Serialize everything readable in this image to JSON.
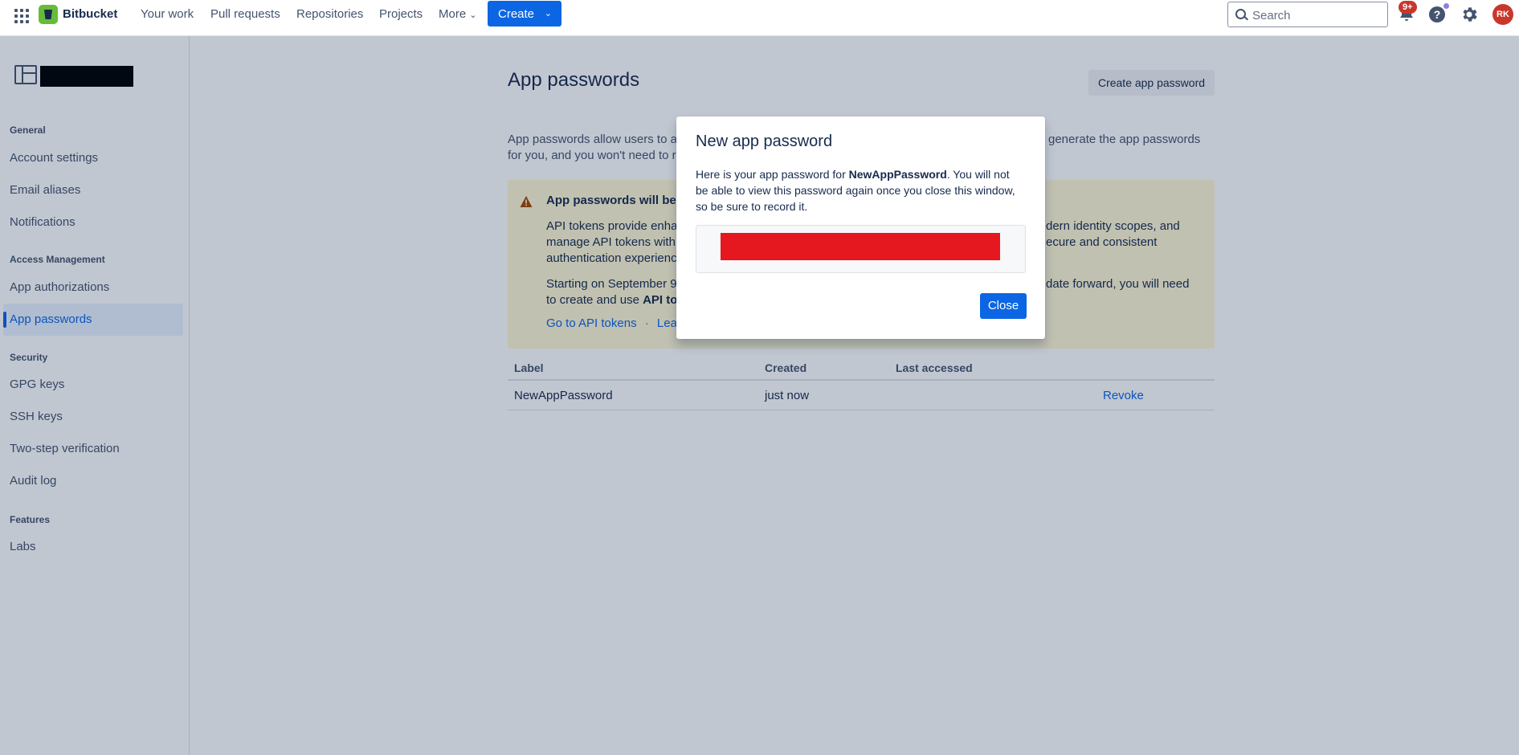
{
  "topnav": {
    "brand": "Bitbucket",
    "items": [
      "Your work",
      "Pull requests",
      "Repositories",
      "Projects",
      "More"
    ],
    "create_label": "Create",
    "search_placeholder": "Search",
    "notification_badge": "9+",
    "avatar_initials": "RK",
    "brand_color": "#65bc38",
    "primary_color": "#0c66e4"
  },
  "sidebar": {
    "sections": {
      "general": "General",
      "access": "Access Management",
      "security": "Security",
      "features": "Features"
    },
    "items": {
      "account_settings": "Account settings",
      "email_aliases": "Email aliases",
      "notifications": "Notifications",
      "app_authorizations": "App authorizations",
      "app_passwords": "App passwords",
      "gpg_keys": "GPG keys",
      "ssh_keys": "SSH keys",
      "two_step": "Two-step verification",
      "audit_log": "Audit log",
      "labs": "Labs"
    },
    "active_item": "App passwords"
  },
  "page": {
    "title": "App passwords",
    "create_button": "Create app password",
    "intro_line1_left": "App passwords allow users to a",
    "intro_line1_right": "generate the app passwords",
    "intro_line2": "for you, and you won't need to r",
    "warning": {
      "title": "App passwords will be r",
      "p1_l1_left": "API tokens provide enha",
      "p1_l1_right": "dern identity scopes, and",
      "p1_l2_left": "manage API tokens with",
      "p1_l2_right": "ecure and consistent",
      "p1_l3": "authentication experienc",
      "p2_l1_left": "Starting on September 9",
      "p2_l1_right": "date forward, you will need",
      "p2_l2_left": "to create and use",
      "p2_l2_bold": "API to",
      "link_api_tokens": "Go to API tokens",
      "link_sep": "·",
      "link_learn": "Lea"
    },
    "table": {
      "headers": [
        "Label",
        "Created",
        "Last accessed"
      ],
      "rows": [
        {
          "label": "NewAppPassword",
          "created": "just now",
          "last_accessed": "",
          "action": "Revoke"
        }
      ]
    }
  },
  "modal": {
    "title": "New app password",
    "text_before": "Here is your app password for ",
    "password_name": "NewAppPassword",
    "text_after": ". You will not be able to view this password again once you close this window, so be sure to record it.",
    "close_button": "Close",
    "redaction_color": "#e5181f"
  }
}
